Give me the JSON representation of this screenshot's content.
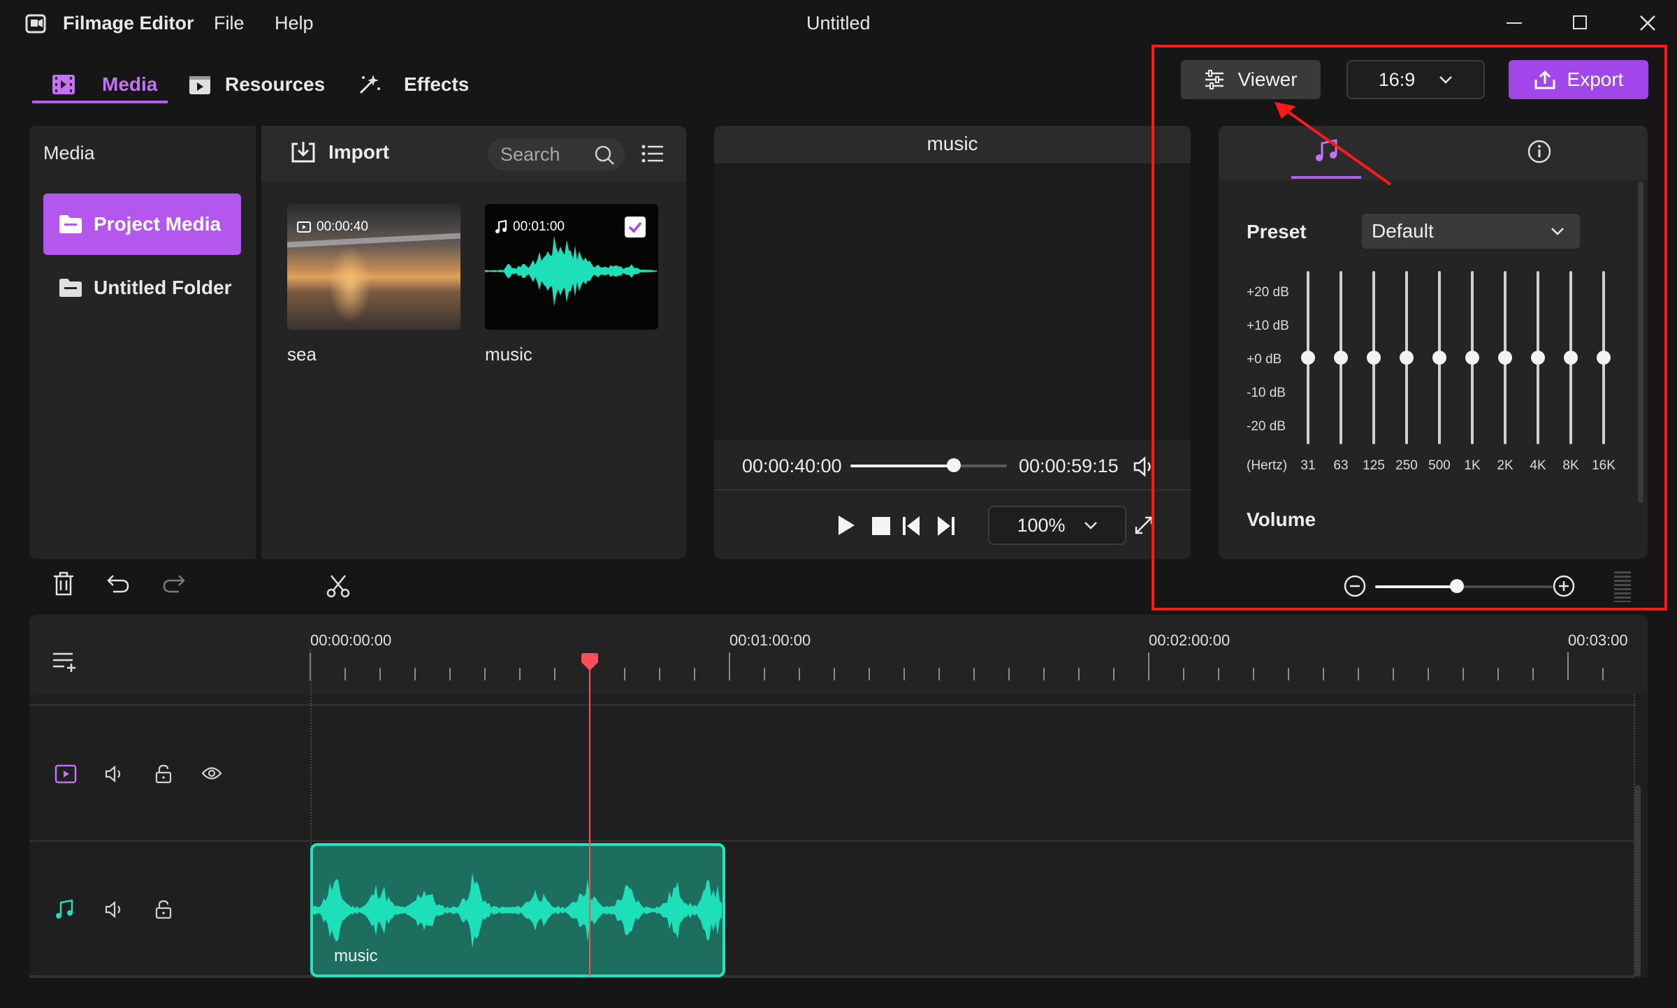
{
  "app": {
    "name": "Filmage Editor",
    "menu": [
      "File",
      "Help"
    ],
    "window_title": "Untitled"
  },
  "nav": {
    "tabs": [
      {
        "label": "Media",
        "icon": "film-icon",
        "active": true
      },
      {
        "label": "Resources",
        "icon": "play-square-icon",
        "active": false
      },
      {
        "label": "Effects",
        "icon": "sparkle-icon",
        "active": false
      }
    ]
  },
  "topbar": {
    "viewer_label": "Viewer",
    "ratio_value": "16:9",
    "export_label": "Export"
  },
  "sidebar": {
    "title": "Media",
    "items": [
      {
        "label": "Project Media",
        "selected": true
      },
      {
        "label": "Untitled Folder",
        "selected": false
      }
    ]
  },
  "media_panel": {
    "import_label": "Import",
    "search_placeholder": "Search",
    "items": [
      {
        "name": "sea",
        "duration": "00:00:40",
        "type": "video",
        "checked": false
      },
      {
        "name": "music",
        "duration": "00:01:00",
        "type": "audio",
        "checked": true
      }
    ]
  },
  "preview": {
    "title": "music",
    "current_time": "00:00:40:00",
    "total_time": "00:00:59:15",
    "progress": 0.66,
    "zoom": "100%"
  },
  "inspector": {
    "preset_label": "Preset",
    "preset_value": "Default",
    "db_labels": [
      "+20 dB",
      "+10 dB",
      "+0 dB",
      "-10 dB",
      "-20 dB"
    ],
    "hertz_label": "(Hertz)",
    "bands": [
      "31",
      "63",
      "125",
      "250",
      "500",
      "1K",
      "2K",
      "4K",
      "8K",
      "16K"
    ],
    "band_gains_db": [
      0,
      0,
      0,
      0,
      0,
      0,
      0,
      0,
      0,
      0
    ],
    "volume_label": "Volume"
  },
  "timeline": {
    "zoom_level": 0.46,
    "ruler_labels": [
      "00:00:00:00",
      "00:01:00:00",
      "00:02:00:00",
      "00:03:00"
    ],
    "clip_label": "music"
  },
  "colors": {
    "accent_purple": "#a046ea",
    "waveform_teal": "#1ee0b8",
    "playhead_red": "#ff4d5e",
    "annotation_red": "#ff1a1a"
  }
}
